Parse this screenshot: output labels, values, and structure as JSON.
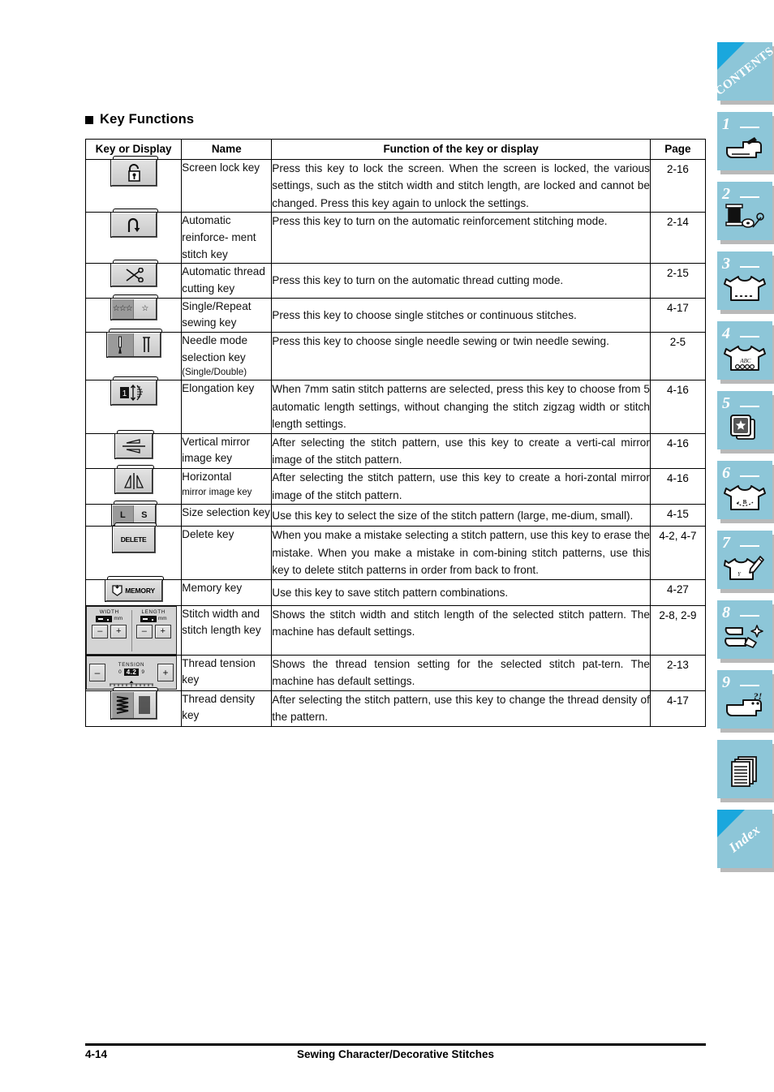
{
  "section": {
    "heading": "Key Functions"
  },
  "table": {
    "headers": [
      "Key or Display",
      "Name",
      "Function of the key or display",
      "Page"
    ],
    "rows": [
      {
        "key_icon": "screen-lock-key-icon",
        "name": "Screen lock key",
        "description": "Press this key to lock the screen. When the screen is locked, the various settings, such as the stitch width and stitch length, are locked and cannot be changed. Press this key again to unlock the settings.",
        "page": "2-16"
      },
      {
        "key_icon": "automatic-reinforcement-stitch-key-icon",
        "name": "Automatic reinforce- ment stitch key",
        "description": "Press this key to turn on the automatic reinforcement stitching mode.",
        "page": "2-14"
      },
      {
        "key_icon": "automatic-thread-cutting-key-icon",
        "name": "Automatic thread cutting key",
        "description": "Press this key to turn on the automatic thread cutting mode.",
        "page": "2-15"
      },
      {
        "key_icon": "single-repeat-sewing-key-icon",
        "name": "Single/Repeat sewing key",
        "description": "Press this key to choose single stitches or continuous stitches.",
        "page": "4-17"
      },
      {
        "key_icon": "needle-mode-selection-key-icon",
        "name": "Needle mode selection key",
        "name_sub": "(Single/Double)",
        "description": "Press this key to choose single needle sewing or twin needle sewing.",
        "page": "2-5"
      },
      {
        "key_icon": "elongation-key-icon",
        "name": "Elongation key",
        "description": "When 7mm satin stitch patterns are selected, press this key to choose from 5 automatic length settings, without changing the stitch zigzag width or stitch length settings.",
        "page": "4-16"
      },
      {
        "key_icon": "vertical-mirror-image-key-icon",
        "name": "Vertical mirror image key",
        "description": "After selecting the stitch pattern, use this key to create a verti-cal mirror image of the stitch pattern.",
        "page": "4-16"
      },
      {
        "key_icon": "horizontal-mirror-image-key-icon",
        "name": "Horizontal",
        "name_sub": "mirror image key",
        "description": "After selecting the stitch pattern, use this key to create a hori-zontal mirror image of the stitch pattern.",
        "page": "4-16"
      },
      {
        "key_icon": "size-selection-key-icon",
        "name": "Size selection key",
        "description": "Use this key to select the size of the stitch pattern (large, me-dium, small).",
        "page": "4-15"
      },
      {
        "key_icon": "delete-key-icon",
        "name": "Delete key",
        "description": "When you make a mistake selecting a stitch pattern, use this key to erase the mistake.  When you make a mistake in com-bining stitch patterns, use this key to delete stitch patterns in order from back to front.",
        "page": "4-2, 4-7"
      },
      {
        "key_icon": "memory-key-icon",
        "name": "Memory key",
        "description": "Use this key to save stitch pattern combinations.",
        "page": "4-27"
      },
      {
        "key_icon": "stitch-width-and-length-key-icon",
        "name": "Stitch width and stitch length key",
        "description": "Shows the stitch width and stitch length of the selected stitch pattern. The machine has default settings.",
        "page": "2-8, 2-9"
      },
      {
        "key_icon": "thread-tension-key-icon",
        "name": "Thread tension key",
        "description": "Shows the thread tension setting for the selected stitch pat-tern. The machine has default settings.",
        "page": "2-13"
      },
      {
        "key_icon": "thread-density-key-icon",
        "name": "Thread density key",
        "description": "After selecting the stitch pattern, use this key to change the thread density of the pattern.",
        "page": "4-17"
      }
    ]
  },
  "key_labels": {
    "delete": "DELETE",
    "memory": "MEMORY",
    "width": "WIDTH",
    "length": "LENGTH",
    "mm": "mm",
    "minus": "–",
    "plus": "+",
    "tension": "TENSION",
    "tension_value": "4.2",
    "tension_min": "0",
    "tension_max": "9",
    "size_large": "L",
    "size_small": "S"
  },
  "footer": {
    "page_number": "4-14",
    "title": "Sewing Character/Decorative Stitches"
  },
  "tabs": [
    {
      "id": "contents",
      "label": "CONTENTS",
      "type": "word"
    },
    {
      "id": "chapter-1",
      "label": "1",
      "type": "num",
      "glyph": "sewing-machine-icon"
    },
    {
      "id": "chapter-2",
      "label": "2",
      "type": "num",
      "glyph": "thread-spool-icon"
    },
    {
      "id": "chapter-3",
      "label": "3",
      "type": "num",
      "glyph": "shirt-icon"
    },
    {
      "id": "chapter-4",
      "label": "4",
      "type": "num",
      "glyph": "shirt-abc-icon"
    },
    {
      "id": "chapter-5",
      "label": "5",
      "type": "num",
      "glyph": "embroidery-card-icon"
    },
    {
      "id": "chapter-6",
      "label": "6",
      "type": "num",
      "glyph": "shirt-monogram-icon"
    },
    {
      "id": "chapter-7",
      "label": "7",
      "type": "num",
      "glyph": "shirt-edit-icon"
    },
    {
      "id": "chapter-8",
      "label": "8",
      "type": "num",
      "glyph": "machine-clean-icon"
    },
    {
      "id": "chapter-9",
      "label": "9",
      "type": "num",
      "glyph": "machine-help-icon"
    },
    {
      "id": "appendix",
      "label": "",
      "type": "plain",
      "glyph": "pages-icon"
    },
    {
      "id": "index",
      "label": "Index",
      "type": "word"
    }
  ],
  "colors": {
    "tab_bg": "#8dc6d8",
    "tab_corner": "#1aa7dd",
    "tab_shadow": "#b9b9b9",
    "key_face": "#d4d4d4",
    "key_selected": "#9a9a9a",
    "text": "#000000"
  }
}
